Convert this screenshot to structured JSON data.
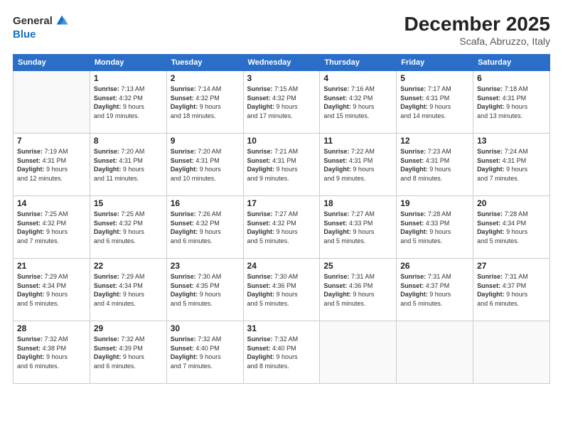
{
  "header": {
    "logo_general": "General",
    "logo_blue": "Blue",
    "month": "December 2025",
    "location": "Scafa, Abruzzo, Italy"
  },
  "weekdays": [
    "Sunday",
    "Monday",
    "Tuesday",
    "Wednesday",
    "Thursday",
    "Friday",
    "Saturday"
  ],
  "weeks": [
    [
      {
        "day": "",
        "info": ""
      },
      {
        "day": "1",
        "info": "Sunrise: 7:13 AM\nSunset: 4:32 PM\nDaylight: 9 hours\nand 19 minutes."
      },
      {
        "day": "2",
        "info": "Sunrise: 7:14 AM\nSunset: 4:32 PM\nDaylight: 9 hours\nand 18 minutes."
      },
      {
        "day": "3",
        "info": "Sunrise: 7:15 AM\nSunset: 4:32 PM\nDaylight: 9 hours\nand 17 minutes."
      },
      {
        "day": "4",
        "info": "Sunrise: 7:16 AM\nSunset: 4:32 PM\nDaylight: 9 hours\nand 15 minutes."
      },
      {
        "day": "5",
        "info": "Sunrise: 7:17 AM\nSunset: 4:31 PM\nDaylight: 9 hours\nand 14 minutes."
      },
      {
        "day": "6",
        "info": "Sunrise: 7:18 AM\nSunset: 4:31 PM\nDaylight: 9 hours\nand 13 minutes."
      }
    ],
    [
      {
        "day": "7",
        "info": "Sunrise: 7:19 AM\nSunset: 4:31 PM\nDaylight: 9 hours\nand 12 minutes."
      },
      {
        "day": "8",
        "info": "Sunrise: 7:20 AM\nSunset: 4:31 PM\nDaylight: 9 hours\nand 11 minutes."
      },
      {
        "day": "9",
        "info": "Sunrise: 7:20 AM\nSunset: 4:31 PM\nDaylight: 9 hours\nand 10 minutes."
      },
      {
        "day": "10",
        "info": "Sunrise: 7:21 AM\nSunset: 4:31 PM\nDaylight: 9 hours\nand 9 minutes."
      },
      {
        "day": "11",
        "info": "Sunrise: 7:22 AM\nSunset: 4:31 PM\nDaylight: 9 hours\nand 9 minutes."
      },
      {
        "day": "12",
        "info": "Sunrise: 7:23 AM\nSunset: 4:31 PM\nDaylight: 9 hours\nand 8 minutes."
      },
      {
        "day": "13",
        "info": "Sunrise: 7:24 AM\nSunset: 4:31 PM\nDaylight: 9 hours\nand 7 minutes."
      }
    ],
    [
      {
        "day": "14",
        "info": "Sunrise: 7:25 AM\nSunset: 4:32 PM\nDaylight: 9 hours\nand 7 minutes."
      },
      {
        "day": "15",
        "info": "Sunrise: 7:25 AM\nSunset: 4:32 PM\nDaylight: 9 hours\nand 6 minutes."
      },
      {
        "day": "16",
        "info": "Sunrise: 7:26 AM\nSunset: 4:32 PM\nDaylight: 9 hours\nand 6 minutes."
      },
      {
        "day": "17",
        "info": "Sunrise: 7:27 AM\nSunset: 4:32 PM\nDaylight: 9 hours\nand 5 minutes."
      },
      {
        "day": "18",
        "info": "Sunrise: 7:27 AM\nSunset: 4:33 PM\nDaylight: 9 hours\nand 5 minutes."
      },
      {
        "day": "19",
        "info": "Sunrise: 7:28 AM\nSunset: 4:33 PM\nDaylight: 9 hours\nand 5 minutes."
      },
      {
        "day": "20",
        "info": "Sunrise: 7:28 AM\nSunset: 4:34 PM\nDaylight: 9 hours\nand 5 minutes."
      }
    ],
    [
      {
        "day": "21",
        "info": "Sunrise: 7:29 AM\nSunset: 4:34 PM\nDaylight: 9 hours\nand 5 minutes."
      },
      {
        "day": "22",
        "info": "Sunrise: 7:29 AM\nSunset: 4:34 PM\nDaylight: 9 hours\nand 4 minutes."
      },
      {
        "day": "23",
        "info": "Sunrise: 7:30 AM\nSunset: 4:35 PM\nDaylight: 9 hours\nand 5 minutes."
      },
      {
        "day": "24",
        "info": "Sunrise: 7:30 AM\nSunset: 4:36 PM\nDaylight: 9 hours\nand 5 minutes."
      },
      {
        "day": "25",
        "info": "Sunrise: 7:31 AM\nSunset: 4:36 PM\nDaylight: 9 hours\nand 5 minutes."
      },
      {
        "day": "26",
        "info": "Sunrise: 7:31 AM\nSunset: 4:37 PM\nDaylight: 9 hours\nand 5 minutes."
      },
      {
        "day": "27",
        "info": "Sunrise: 7:31 AM\nSunset: 4:37 PM\nDaylight: 9 hours\nand 6 minutes."
      }
    ],
    [
      {
        "day": "28",
        "info": "Sunrise: 7:32 AM\nSunset: 4:38 PM\nDaylight: 9 hours\nand 6 minutes."
      },
      {
        "day": "29",
        "info": "Sunrise: 7:32 AM\nSunset: 4:39 PM\nDaylight: 9 hours\nand 6 minutes."
      },
      {
        "day": "30",
        "info": "Sunrise: 7:32 AM\nSunset: 4:40 PM\nDaylight: 9 hours\nand 7 minutes."
      },
      {
        "day": "31",
        "info": "Sunrise: 7:32 AM\nSunset: 4:40 PM\nDaylight: 9 hours\nand 8 minutes."
      },
      {
        "day": "",
        "info": ""
      },
      {
        "day": "",
        "info": ""
      },
      {
        "day": "",
        "info": ""
      }
    ]
  ]
}
